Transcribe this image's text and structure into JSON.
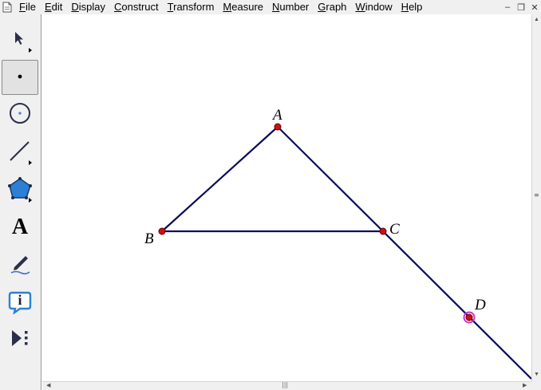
{
  "menubar": {
    "items": [
      {
        "accel": "F",
        "rest": "ile"
      },
      {
        "accel": "E",
        "rest": "dit"
      },
      {
        "accel": "D",
        "rest": "isplay"
      },
      {
        "accel": "C",
        "rest": "onstruct"
      },
      {
        "accel": "T",
        "rest": "ransform"
      },
      {
        "accel": "M",
        "rest": "easure"
      },
      {
        "accel": "N",
        "rest": "umber"
      },
      {
        "accel": "G",
        "rest": "raph"
      },
      {
        "accel": "W",
        "rest": "indow"
      },
      {
        "accel": "H",
        "rest": "elp"
      }
    ],
    "window_controls": [
      "–",
      "❐",
      "✕"
    ]
  },
  "toolbox": {
    "tools": [
      {
        "name": "arrow-tool",
        "icon": "selection-arrow-icon",
        "active": false
      },
      {
        "name": "point-tool",
        "icon": "point-icon",
        "active": true
      },
      {
        "name": "compass-tool",
        "icon": "circle-icon",
        "active": false
      },
      {
        "name": "straightedge-tool",
        "icon": "line-segment-icon",
        "active": false
      },
      {
        "name": "polygon-tool",
        "icon": "polygon-icon",
        "active": false
      },
      {
        "name": "text-tool",
        "icon": "text-icon",
        "active": false,
        "glyph": "A"
      },
      {
        "name": "marker-tool",
        "icon": "marker-pen-icon",
        "active": false
      },
      {
        "name": "information-tool",
        "icon": "information-icon",
        "active": false,
        "glyph": "i"
      },
      {
        "name": "custom-tool",
        "icon": "custom-tools-icon",
        "active": false
      }
    ]
  },
  "sketch": {
    "points": {
      "A": {
        "label": "A"
      },
      "B": {
        "label": "B"
      },
      "C": {
        "label": "C"
      },
      "D": {
        "label": "D",
        "selected": true
      }
    },
    "segments": [
      "AB",
      "AC",
      "BC"
    ],
    "ray": "CD",
    "colors": {
      "line": "#0a0a5a",
      "point_fill": "#cc1111",
      "point_stroke": "#660000",
      "selection": "#cc33cc"
    }
  }
}
